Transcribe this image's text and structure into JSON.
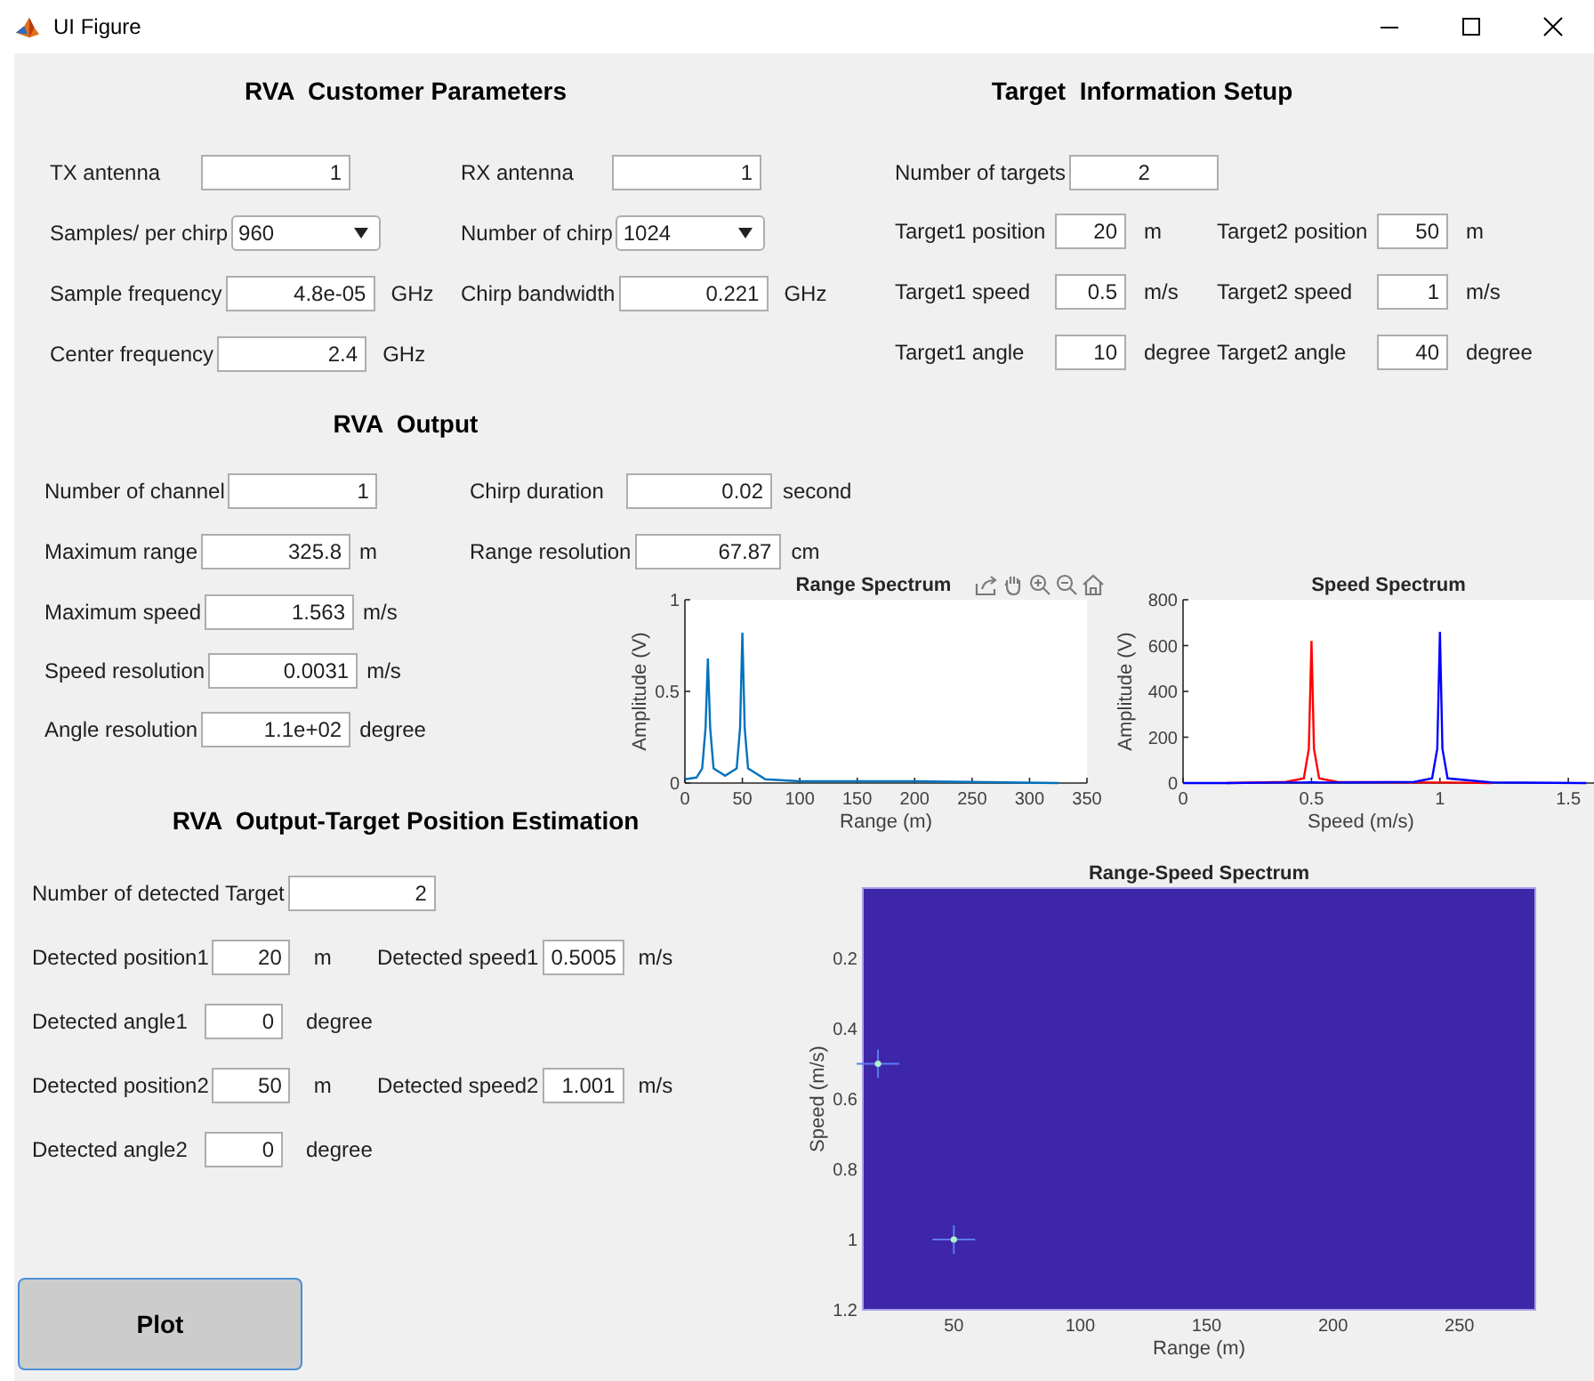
{
  "window": {
    "title": "UI Figure"
  },
  "customer_parameters": {
    "title": "RVA  Customer Parameters",
    "fields": [
      {
        "kind": "edit",
        "label": "TX antenna",
        "value": "1"
      },
      {
        "kind": "edit",
        "label": "RX antenna",
        "value": "1"
      },
      {
        "kind": "dropdown",
        "label": "Samples/ per chirp",
        "value": "960"
      },
      {
        "kind": "dropdown",
        "label": "Number of chirp",
        "value": "1024"
      },
      {
        "kind": "edit",
        "label": "Sample frequency",
        "value": "4.8e-05",
        "unit": "GHz"
      },
      {
        "kind": "edit",
        "label": "Chirp bandwidth",
        "value": "0.221",
        "unit": "GHz"
      },
      {
        "kind": "edit",
        "label": "Center frequency",
        "value": "2.4",
        "unit": "GHz"
      }
    ]
  },
  "target_setup": {
    "title": "Target  Information Setup",
    "count": {
      "label": "Number of targets",
      "value": "2"
    },
    "fields": [
      {
        "label": "Target1 position",
        "value": "20",
        "unit": "m"
      },
      {
        "label": "Target2 position",
        "value": "50",
        "unit": "m"
      },
      {
        "label": "Target1 speed",
        "value": "0.5",
        "unit": "m/s"
      },
      {
        "label": "Target2 speed",
        "value": "1",
        "unit": "m/s"
      },
      {
        "label": "Target1 angle",
        "value": "10",
        "unit": "degree"
      },
      {
        "label": "Target2 angle",
        "value": "40",
        "unit": "degree"
      }
    ]
  },
  "output": {
    "title": "RVA  Output",
    "fields_left": [
      {
        "label": "Number of channel",
        "value": "1"
      },
      {
        "label": "Maximum range",
        "value": "325.8",
        "unit": "m"
      },
      {
        "label": "Maximum speed",
        "value": "1.563",
        "unit": "m/s"
      },
      {
        "label": "Speed resolution",
        "value": "0.0031",
        "unit": "m/s"
      },
      {
        "label": "Angle resolution",
        "value": "1.1e+02",
        "unit": "degree"
      }
    ],
    "fields_right": [
      {
        "label": "Chirp duration",
        "value": "0.02",
        "unit": "second"
      },
      {
        "label": "Range resolution",
        "value": "67.87",
        "unit": "cm"
      }
    ]
  },
  "range_spectrum": {
    "chart_data": {
      "type": "line",
      "title": "Range Spectrum",
      "xlabel": "Range (m)",
      "ylabel": "Amplitude (V)",
      "x": [
        0,
        10,
        15,
        18,
        20,
        22,
        25,
        35,
        45,
        48,
        50,
        52,
        55,
        70,
        100,
        200,
        325
      ],
      "series": [
        {
          "color": "#0072bd",
          "values": [
            0.02,
            0.03,
            0.08,
            0.3,
            0.68,
            0.3,
            0.08,
            0.04,
            0.08,
            0.3,
            0.82,
            0.3,
            0.08,
            0.02,
            0.01,
            0.01,
            0
          ]
        }
      ],
      "xlim": [
        0,
        350
      ],
      "ylim": [
        0,
        1
      ],
      "xticks": [
        0,
        50,
        100,
        150,
        200,
        250,
        300,
        350
      ],
      "yticks": [
        0,
        0.5,
        1
      ]
    }
  },
  "speed_spectrum": {
    "chart_data": {
      "type": "line",
      "title": "Speed Spectrum",
      "xlabel": "Speed (m/s)",
      "ylabel": "Amplitude (V)",
      "x": [
        0,
        0.17,
        0.4,
        0.47,
        0.49,
        0.5,
        0.51,
        0.53,
        0.6,
        0.9,
        0.97,
        0.99,
        1,
        1.01,
        1.03,
        1.2,
        1.57
      ],
      "series": [
        {
          "color": "#ff0000",
          "values": [
            null,
            0,
            5,
            20,
            150,
            620,
            150,
            20,
            5,
            3,
            2,
            2,
            2,
            2,
            2,
            0,
            null
          ]
        },
        {
          "color": "#0000ff",
          "values": [
            0,
            0,
            2,
            2,
            3,
            3,
            3,
            2,
            2,
            5,
            20,
            150,
            660,
            150,
            20,
            3,
            0
          ]
        }
      ],
      "xlim": [
        0,
        1.6
      ],
      "ylim": [
        0,
        800
      ],
      "xticks": [
        0,
        0.5,
        1,
        1.5
      ],
      "yticks": [
        0,
        200,
        400,
        600,
        800
      ]
    }
  },
  "estimation": {
    "title": "RVA  Output-Target Position Estimation",
    "count": {
      "label": "Number of detected Target",
      "value": "2"
    },
    "rows": [
      [
        {
          "label": "Detected position1",
          "value": "20",
          "unit": "m"
        },
        {
          "label": "Detected speed1",
          "value": "0.5005",
          "unit": "m/s"
        }
      ],
      [
        {
          "label": "Detected angle1",
          "value": "0",
          "unit": "degree"
        }
      ],
      [
        {
          "label": "Detected position2",
          "value": "50",
          "unit": "m"
        },
        {
          "label": "Detected speed2",
          "value": "1.001",
          "unit": "m/s"
        }
      ],
      [
        {
          "label": "Detected angle2",
          "value": "0",
          "unit": "degree"
        }
      ]
    ]
  },
  "range_speed_spectrum": {
    "chart_data": {
      "type": "scatter",
      "title": "Range-Speed Spectrum",
      "xlabel": "Range (m)",
      "ylabel": "Speed (m/s)",
      "x": [
        20,
        50
      ],
      "series": [
        {
          "color": "#aef5c8",
          "values": [
            0.5,
            1
          ]
        }
      ],
      "xlim": [
        14,
        280
      ],
      "ylim": [
        1.2,
        0
      ],
      "xticks": [
        50,
        100,
        150,
        200,
        250
      ],
      "yticks": [
        0.2,
        0.4,
        0.6,
        0.8,
        1,
        1.2
      ]
    }
  },
  "plot_button": {
    "label": "Plot"
  }
}
